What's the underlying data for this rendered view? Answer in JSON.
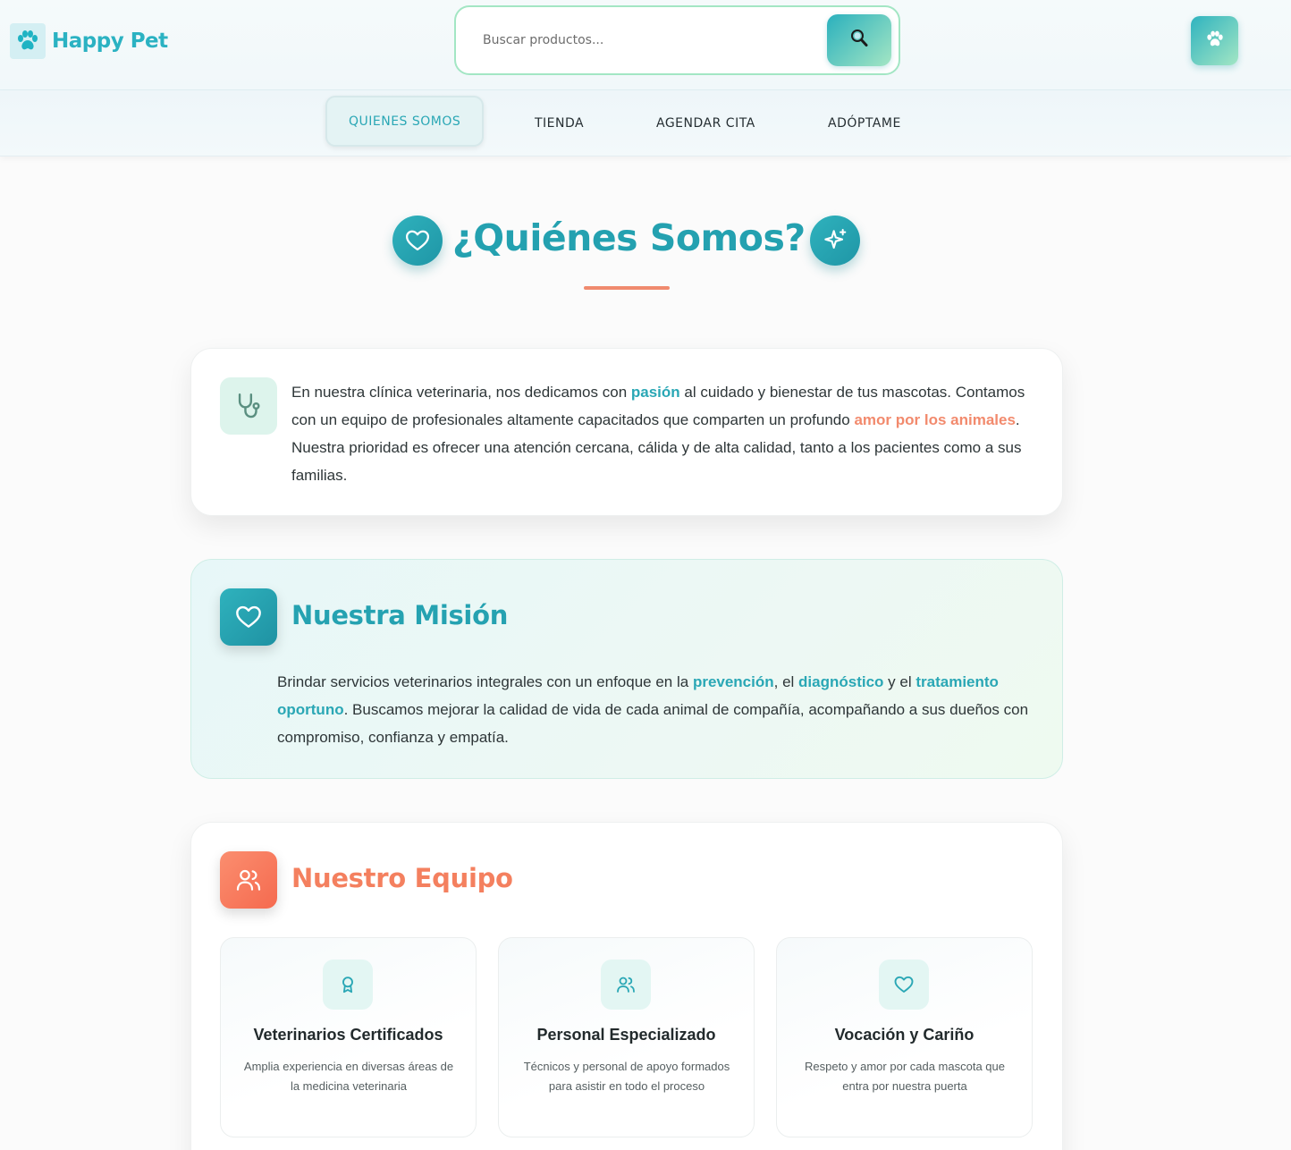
{
  "brand": {
    "name": "Happy Pet",
    "logo_icon": "paw-icon"
  },
  "search": {
    "placeholder": "Buscar productos...",
    "button_icon": "search-icon"
  },
  "profile_button_icon": "paw-icon",
  "nav": {
    "items": [
      {
        "label": "QUIENES SOMOS",
        "active": true
      },
      {
        "label": "TIENDA",
        "active": false
      },
      {
        "label": "AGENDAR CITA",
        "active": false
      },
      {
        "label": "ADÓPTAME",
        "active": false
      }
    ]
  },
  "page": {
    "title": "¿Quiénes Somos?",
    "left_icon": "heart-icon",
    "right_icon": "sparkle-icon"
  },
  "intro": {
    "icon": "stethoscope-icon",
    "text": {
      "a": "En nuestra clínica veterinaria, nos dedicamos con ",
      "b": "pasión",
      "c": " al cuidado y bienestar de tus mascotas. Contamos con un equipo de profesionales altamente capacitados que comparten un profundo ",
      "d": "amor por los animales",
      "e": ". Nuestra prioridad es ofrecer una atención cercana, cálida y de alta calidad, tanto a los pacientes como a sus familias."
    }
  },
  "mision": {
    "icon": "heart-icon",
    "title": "Nuestra Misión",
    "text": {
      "a": "Brindar servicios veterinarios integrales con un enfoque en la ",
      "b": "prevención",
      "c": ", el ",
      "d": "diagnóstico",
      "e": " y el ",
      "f": "tratamiento oportuno",
      "g": ". Buscamos mejorar la calidad de vida de cada animal de compañía, acompañando a sus dueños con compromiso, confianza y empatía."
    }
  },
  "equipo": {
    "icon": "users-icon",
    "title": "Nuestro Equipo",
    "cards": [
      {
        "icon": "award-icon",
        "title": "Veterinarios Certificados",
        "desc": "Amplia experiencia en diversas áreas de la medicina veterinaria"
      },
      {
        "icon": "users-icon",
        "title": "Personal Especializado",
        "desc": "Técnicos y personal de apoyo formados para asistir en todo el proceso"
      },
      {
        "icon": "heart-icon",
        "title": "Vocación y Cariño",
        "desc": "Respeto y amor por cada mascota que entra por nuestra puerta"
      }
    ]
  },
  "colors": {
    "teal": "#2aa7b5",
    "coral": "#f28a6d",
    "mint": "#a3e6c4"
  }
}
